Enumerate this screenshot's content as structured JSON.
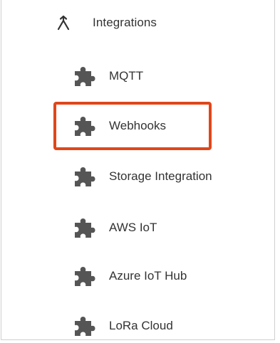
{
  "header": {
    "label": "Integrations",
    "icon": "merge-icon"
  },
  "items": [
    {
      "label": "MQTT",
      "icon": "puzzle-icon"
    },
    {
      "label": "Webhooks",
      "icon": "puzzle-icon"
    },
    {
      "label": "Storage Integration",
      "icon": "puzzle-icon"
    },
    {
      "label": "AWS IoT",
      "icon": "puzzle-icon"
    },
    {
      "label": "Azure IoT Hub",
      "icon": "puzzle-icon"
    },
    {
      "label": "LoRa Cloud",
      "icon": "puzzle-icon"
    }
  ],
  "highlight": {
    "target": "Webhooks",
    "color": "#e0461a"
  },
  "colors": {
    "text": "#333333",
    "icon": "#555555",
    "border": "#cfcfcf"
  }
}
